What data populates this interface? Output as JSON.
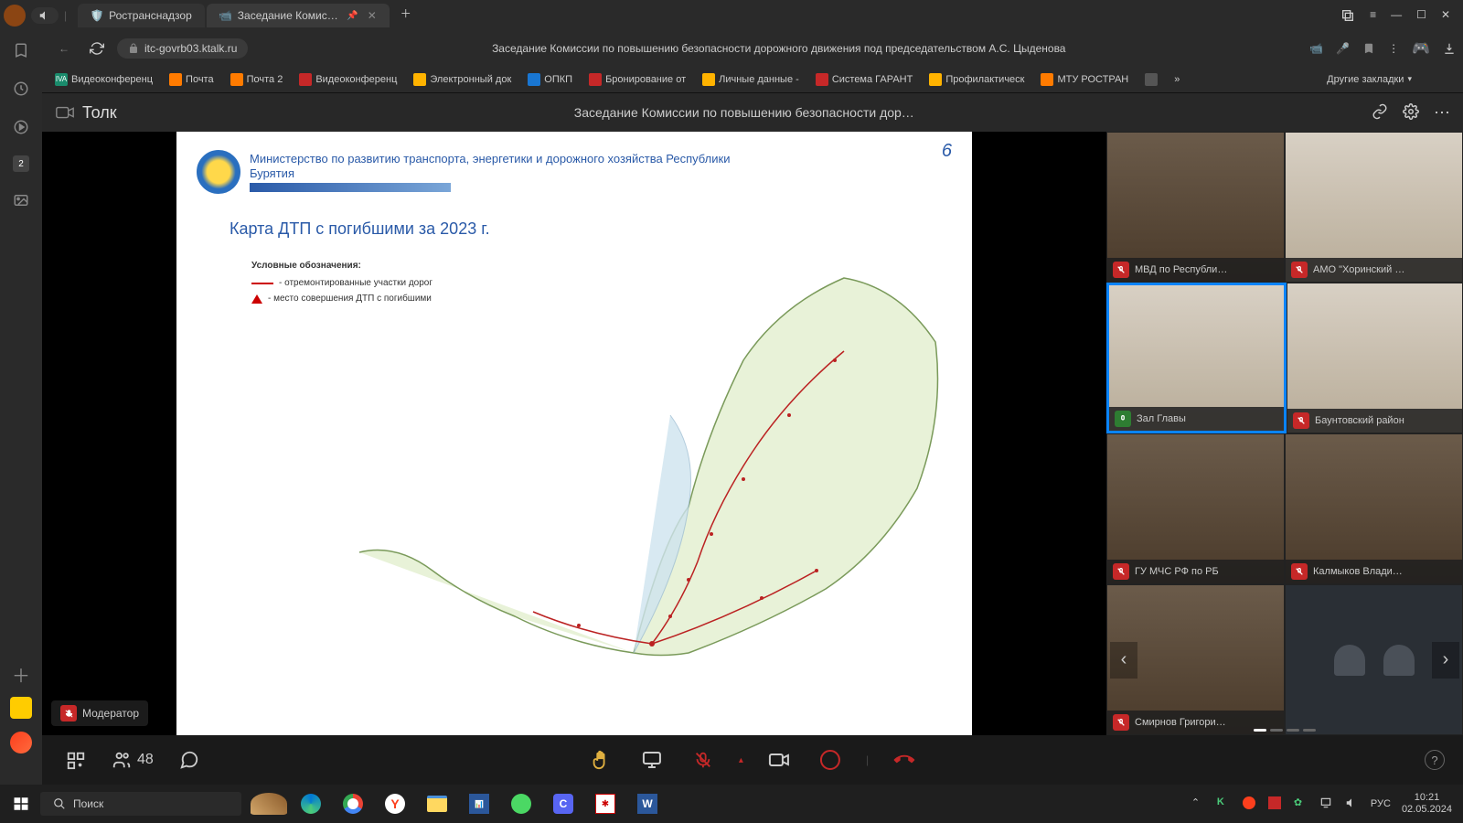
{
  "titlebar": {
    "tabs": [
      {
        "label": "Ространснадзор"
      },
      {
        "label": "Заседание Комисси…"
      }
    ]
  },
  "addressbar": {
    "url": "itc-govrb03.ktalk.ru",
    "page_title": "Заседание Комиссии по повышению безопасности дорожного движения под председательством А.С. Цыденова"
  },
  "bookmarks": [
    {
      "label": "Видеоконференц",
      "color": "#1a8b6c"
    },
    {
      "label": "Почта",
      "color": "#ff7b00"
    },
    {
      "label": "Почта 2",
      "color": "#ff7b00"
    },
    {
      "label": "Видеоконференц",
      "color": "#c62828"
    },
    {
      "label": "Электронный док",
      "color": "#ffb300"
    },
    {
      "label": "ОПКП",
      "color": "#1976d2"
    },
    {
      "label": "Бронирование от",
      "color": "#c62828"
    },
    {
      "label": "Личные данные -",
      "color": "#ffb300"
    },
    {
      "label": "Система ГАРАНТ",
      "color": "#c62828"
    },
    {
      "label": "Профилактическ",
      "color": "#ffb300"
    },
    {
      "label": "МТУ РОСТРАН",
      "color": "#ff7b00"
    }
  ],
  "bookmarks_other": "Другие закладки",
  "sidebar": {
    "badge": "2"
  },
  "tolk": {
    "brand": "Толк",
    "title": "Заседание Комиссии по повышению безопасности дор…"
  },
  "slide": {
    "number": "6",
    "org": "Министерство по развитию транспорта, энергетики и дорожного хозяйства Республики Бурятия",
    "map_title": "Карта ДТП с погибшими за 2023 г.",
    "legend_title": "Условные обозначения:",
    "legend1": "- отремонтированные участки дорог",
    "legend2": "- место совершения ДТП с погибшими"
  },
  "moderator": {
    "label": "Модератор"
  },
  "participants": [
    {
      "name": "МВД по Республи…",
      "mic": "off"
    },
    {
      "name": "АМО \"Хоринский …",
      "mic": "off"
    },
    {
      "name": "Зал Главы",
      "mic": "on",
      "active": true
    },
    {
      "name": "Баунтовский район",
      "mic": "off"
    },
    {
      "name": "ГУ МЧС РФ по РБ",
      "mic": "off"
    },
    {
      "name": "Калмыков Влади…",
      "mic": "off"
    },
    {
      "name": "Смирнов Григори…",
      "mic": "off"
    },
    {
      "name": "",
      "silhouette": true
    }
  ],
  "controls": {
    "participant_count": "48"
  },
  "taskbar": {
    "search": "Поиск",
    "lang": "РУС",
    "time": "10:21",
    "date": "02.05.2024"
  }
}
